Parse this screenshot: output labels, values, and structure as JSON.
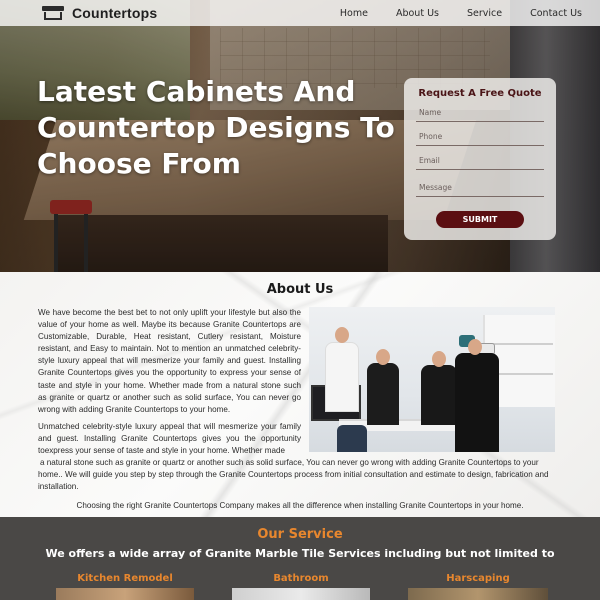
{
  "nav": {
    "logo": "Countertops",
    "menu": [
      "Home",
      "About Us",
      "Service",
      "Contact Us"
    ]
  },
  "hero": {
    "title": "Latest Cabinets And Countertop Designs To Choose From"
  },
  "quote_form": {
    "heading": "Request A Free Quote",
    "fields": [
      "Name",
      "Phone",
      "Email",
      "Message"
    ],
    "submit": "SUBMIT"
  },
  "about": {
    "heading": "About Us",
    "paragraph1": "We have become the best bet to not only uplift your lifestyle but also the value of your home as well. Maybe its because Granite Countertops are Customizable, Durable, Heat resistant, Cutlery resistant, Moisture resistant, and Easy to maintain. Not to mention an unmatched celebrity-style luxury appeal that will mesmerize your family and guest. Installing Granite Countertops gives you the opportunity to express your sense of taste and style in your home. Whether made from a natural stone such as granite or quartz or another such as solid surface, You can never go wrong with adding Granite Countertops to your home.",
    "paragraph2": "Unmatched celebrity-style luxury appeal that will mesmerize your family and guest. Installing Granite Countertops gives you the opportunity toexpress your sense of taste and style in your home. Whether made",
    "paragraph3": "a natural stone such as granite or quartz or another such as solid surface, You can never go wrong with adding Granite Countertops to your home.. We will guide you step by step through the Granite Countertops process from initial consultation and estimate to design, fabrication and installation.",
    "paragraph4": "Choosing the right Granite Countertops Company makes all the difference when installing Granite Countertops in your home."
  },
  "service": {
    "heading": "Our Service",
    "subheading": "We offers a wide array of Granite Marble Tile Services including but not limited to",
    "cards": [
      "Kitchen Remodel",
      "Bathroom",
      "Harscaping"
    ]
  },
  "colors": {
    "brand_dark": "#5b0f12",
    "accent_orange": "#e8872e",
    "service_bg": "#4a4846",
    "quote_heading": "#4a1416"
  }
}
